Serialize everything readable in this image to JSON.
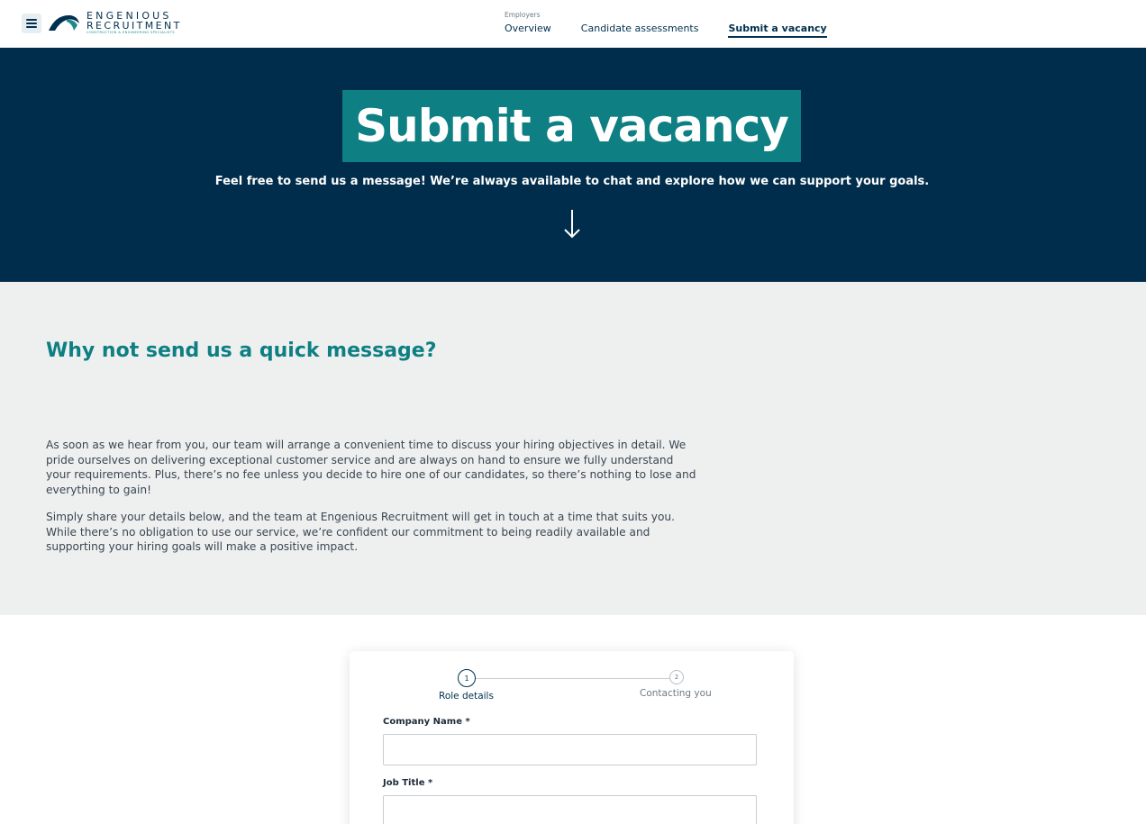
{
  "header": {
    "logo": {
      "line1": "ENGENIOUS",
      "line2": "RECRUITMENT",
      "tagline": "CONSTRUCTION & ENGINEERING SPECIALISTS"
    },
    "nav": {
      "section": "Employers",
      "items": [
        {
          "label": "Overview"
        },
        {
          "label": "Candidate assessments"
        },
        {
          "label": "Submit a vacancy"
        }
      ]
    }
  },
  "hero": {
    "title": "Submit a vacancy",
    "subtitle": "Feel free to send us a message! We’re always available to chat and explore how we can support your goals."
  },
  "intro": {
    "heading": "Why not send us a quick message?",
    "paragraph1": "As soon as we hear from you, our team will arrange a convenient time to discuss your hiring objectives in detail. We pride ourselves on delivering exceptional customer service and are always on hand to ensure we fully understand your requirements. Plus, there’s no fee unless you decide to hire one of our candidates, so there’s nothing to lose and everything to gain!",
    "paragraph2": "Simply share your details below, and the team at Engenious Recruitment will get in touch at a time that suits you. While there’s no obligation to use our service, we’re confident our commitment to being readily available and supporting your hiring goals will make a positive impact."
  },
  "form": {
    "steps": [
      {
        "number": "1",
        "label": "Role details"
      },
      {
        "number": "2",
        "label": "Contacting you"
      }
    ],
    "fields": {
      "company": {
        "label": "Company Name *",
        "value": ""
      },
      "job": {
        "label": "Job Title *",
        "value": ""
      }
    }
  },
  "colors": {
    "navy": "#002d4b",
    "teal": "#0e7f82",
    "light_bg": "#eef0f0"
  }
}
